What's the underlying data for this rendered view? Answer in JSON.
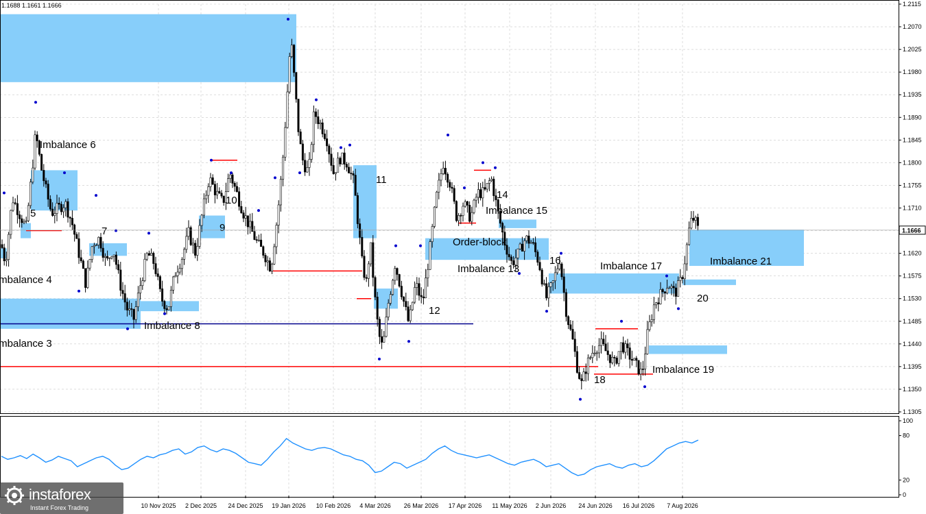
{
  "header": {
    "ohlc_text": "1.1688 1.1661 1.1666"
  },
  "logo": {
    "name": "instaforex",
    "tagline": "Instant Forex Trading"
  },
  "colors": {
    "zone_fill": "#87CEFA",
    "level_red": "#FF0000",
    "level_blue": "#00008B",
    "candle_line": "#000000",
    "fractal_marker": "#0000CD",
    "indicator_line": "#1E90FF",
    "grid": "#c8c8c8"
  },
  "chart_data": [
    {
      "type": "candlestick",
      "title": "",
      "ylim": [
        1.1305,
        1.2115
      ],
      "y_ticks": [
        "1.2115",
        "1.2070",
        "1.2025",
        "1.1980",
        "1.1935",
        "1.1890",
        "1.1845",
        "1.1800",
        "1.1755",
        "1.1710",
        "1.1665",
        "1.1620",
        "1.1575",
        "1.1530",
        "1.1485",
        "1.1440",
        "1.1395",
        "1.1350",
        "1.1305"
      ],
      "current_price": "1.1666",
      "x_ticks": [
        "10 Nov 2025",
        "2 Dec 2025",
        "24 Dec 2025",
        "19 Jan 2026",
        "10 Feb 2026",
        "4 Mar 2026",
        "26 Mar 2026",
        "17 Apr 2026",
        "11 May 2026",
        "2 Jun 2026",
        "24 Jun 2026",
        "16 Jul 2026",
        "7 Aug 2026"
      ],
      "grid": true,
      "price_path": [
        [
          0,
          1.165
        ],
        [
          8,
          1.16
        ],
        [
          18,
          1.173
        ],
        [
          28,
          1.17
        ],
        [
          38,
          1.167
        ],
        [
          45,
          1.176
        ],
        [
          52,
          1.186
        ],
        [
          60,
          1.179
        ],
        [
          68,
          1.174
        ],
        [
          75,
          1.17
        ],
        [
          85,
          1.171
        ],
        [
          95,
          1.172
        ],
        [
          105,
          1.168
        ],
        [
          115,
          1.162
        ],
        [
          125,
          1.156
        ],
        [
          135,
          1.164
        ],
        [
          145,
          1.165
        ],
        [
          155,
          1.16
        ],
        [
          165,
          1.163
        ],
        [
          175,
          1.156
        ],
        [
          185,
          1.151
        ],
        [
          195,
          1.149
        ],
        [
          205,
          1.156
        ],
        [
          215,
          1.162
        ],
        [
          225,
          1.16
        ],
        [
          235,
          1.153
        ],
        [
          245,
          1.151
        ],
        [
          255,
          1.158
        ],
        [
          265,
          1.161
        ],
        [
          275,
          1.166
        ],
        [
          285,
          1.162
        ],
        [
          295,
          1.17
        ],
        [
          305,
          1.177
        ],
        [
          315,
          1.174
        ],
        [
          325,
          1.172
        ],
        [
          335,
          1.178
        ],
        [
          345,
          1.174
        ],
        [
          355,
          1.17
        ],
        [
          365,
          1.167
        ],
        [
          375,
          1.164
        ],
        [
          385,
          1.162
        ],
        [
          395,
          1.159
        ],
        [
          405,
          1.17
        ],
        [
          412,
          1.18
        ],
        [
          418,
          1.192
        ],
        [
          424,
          1.205
        ],
        [
          430,
          1.195
        ],
        [
          436,
          1.185
        ],
        [
          442,
          1.18
        ],
        [
          450,
          1.178
        ],
        [
          458,
          1.19
        ],
        [
          466,
          1.188
        ],
        [
          476,
          1.185
        ],
        [
          486,
          1.178
        ],
        [
          496,
          1.181
        ],
        [
          506,
          1.18
        ],
        [
          516,
          1.176
        ],
        [
          522,
          1.168
        ],
        [
          528,
          1.16
        ],
        [
          534,
          1.156
        ],
        [
          540,
          1.164
        ],
        [
          546,
          1.154
        ],
        [
          552,
          1.146
        ],
        [
          558,
          1.143
        ],
        [
          566,
          1.152
        ],
        [
          576,
          1.16
        ],
        [
          586,
          1.154
        ],
        [
          596,
          1.148
        ],
        [
          606,
          1.156
        ],
        [
          616,
          1.152
        ],
        [
          626,
          1.162
        ],
        [
          636,
          1.173
        ],
        [
          646,
          1.18
        ],
        [
          656,
          1.176
        ],
        [
          666,
          1.169
        ],
        [
          676,
          1.172
        ],
        [
          686,
          1.169
        ],
        [
          696,
          1.174
        ],
        [
          706,
          1.174
        ],
        [
          716,
          1.177
        ],
        [
          726,
          1.17
        ],
        [
          736,
          1.164
        ],
        [
          746,
          1.16
        ],
        [
          756,
          1.162
        ],
        [
          766,
          1.165
        ],
        [
          776,
          1.164
        ],
        [
          786,
          1.16
        ],
        [
          796,
          1.153
        ],
        [
          806,
          1.156
        ],
        [
          816,
          1.161
        ],
        [
          826,
          1.15
        ],
        [
          836,
          1.144
        ],
        [
          842,
          1.139
        ],
        [
          848,
          1.136
        ],
        [
          856,
          1.14
        ],
        [
          866,
          1.143
        ],
        [
          876,
          1.144
        ],
        [
          886,
          1.142
        ],
        [
          896,
          1.14
        ],
        [
          906,
          1.144
        ],
        [
          916,
          1.142
        ],
        [
          926,
          1.14
        ],
        [
          936,
          1.138
        ],
        [
          944,
          1.146
        ],
        [
          954,
          1.152
        ],
        [
          964,
          1.154
        ],
        [
          974,
          1.156
        ],
        [
          984,
          1.154
        ],
        [
          994,
          1.157
        ],
        [
          1000,
          1.162
        ],
        [
          1006,
          1.168
        ],
        [
          1012,
          1.169
        ],
        [
          1018,
          1.1666
        ]
      ],
      "annotations": [
        {
          "label": "Imbalance 6"
        },
        {
          "label": "5"
        },
        {
          "label": "7"
        },
        {
          "label": "Imbalance 4"
        },
        {
          "label": "Imbalance 3"
        },
        {
          "label": "Imbalance 8"
        },
        {
          "label": "9"
        },
        {
          "label": "10"
        },
        {
          "label": "11"
        },
        {
          "label": "12"
        },
        {
          "label": "14"
        },
        {
          "label": "Imbalance 15"
        },
        {
          "label": "Order-block"
        },
        {
          "label": "Imbalance 13"
        },
        {
          "label": "16"
        },
        {
          "label": "Imbalance 17"
        },
        {
          "label": "Imbalance 21"
        },
        {
          "label": "20"
        },
        {
          "label": "Imbalance 19"
        },
        {
          "label": "18"
        }
      ],
      "zones": [
        {
          "from": 1.196,
          "to": 1.2095
        },
        {
          "from": 1.18,
          "to": 1.175
        },
        {
          "from": 1.161,
          "to": 1.163
        },
        {
          "from": 1.147,
          "to": 1.153
        },
        {
          "from": 1.1645,
          "to": 1.167
        },
        {
          "from": 1.173,
          "to": 1.164
        },
        {
          "from": 1.1795,
          "to": 1.1645
        },
        {
          "from": 1.148,
          "to": 1.1545
        },
        {
          "from": 1.161,
          "to": 1.165
        },
        {
          "from": 1.167,
          "to": 1.169
        },
        {
          "from": 1.155,
          "to": 1.1585
        },
        {
          "from": 1.1595,
          "to": 1.1665
        },
        {
          "from": 1.1555,
          "to": 1.1565
        },
        {
          "from": 1.142,
          "to": 1.1435
        }
      ],
      "levels": [
        {
          "price": 1.1665,
          "color": "red"
        },
        {
          "price": 1.18,
          "color": "red"
        },
        {
          "price": 1.1585,
          "color": "red"
        },
        {
          "price": 1.153,
          "color": "red"
        },
        {
          "price": 1.148,
          "color": "blue"
        },
        {
          "price": 1.1395,
          "color": "red"
        },
        {
          "price": 1.168,
          "color": "red"
        },
        {
          "price": 1.1785,
          "color": "red"
        },
        {
          "price": 1.147,
          "color": "red"
        },
        {
          "price": 1.138,
          "color": "red"
        }
      ]
    },
    {
      "type": "line",
      "title": "",
      "ylim": [
        0,
        100
      ],
      "y_ticks": [
        "100",
        "80",
        "20",
        "0"
      ],
      "values": [
        52,
        48,
        50,
        53,
        49,
        55,
        50,
        44,
        47,
        52,
        49,
        46,
        38,
        42,
        46,
        50,
        52,
        48,
        40,
        34,
        36,
        42,
        48,
        52,
        50,
        54,
        56,
        60,
        62,
        55,
        58,
        64,
        66,
        61,
        58,
        62,
        60,
        56,
        50,
        44,
        42,
        40,
        48,
        58,
        66,
        76,
        70,
        66,
        62,
        60,
        63,
        64,
        62,
        58,
        54,
        52,
        48,
        46,
        40,
        30,
        32,
        38,
        44,
        42,
        36,
        40,
        44,
        48,
        56,
        62,
        66,
        60,
        56,
        54,
        52,
        50,
        52,
        54,
        50,
        46,
        42,
        40,
        44,
        46,
        48,
        44,
        38,
        40,
        42,
        36,
        30,
        26,
        28,
        34,
        38,
        40,
        42,
        38,
        36,
        40,
        42,
        38,
        40,
        46,
        54,
        62,
        66,
        70,
        72,
        70,
        74
      ]
    }
  ]
}
